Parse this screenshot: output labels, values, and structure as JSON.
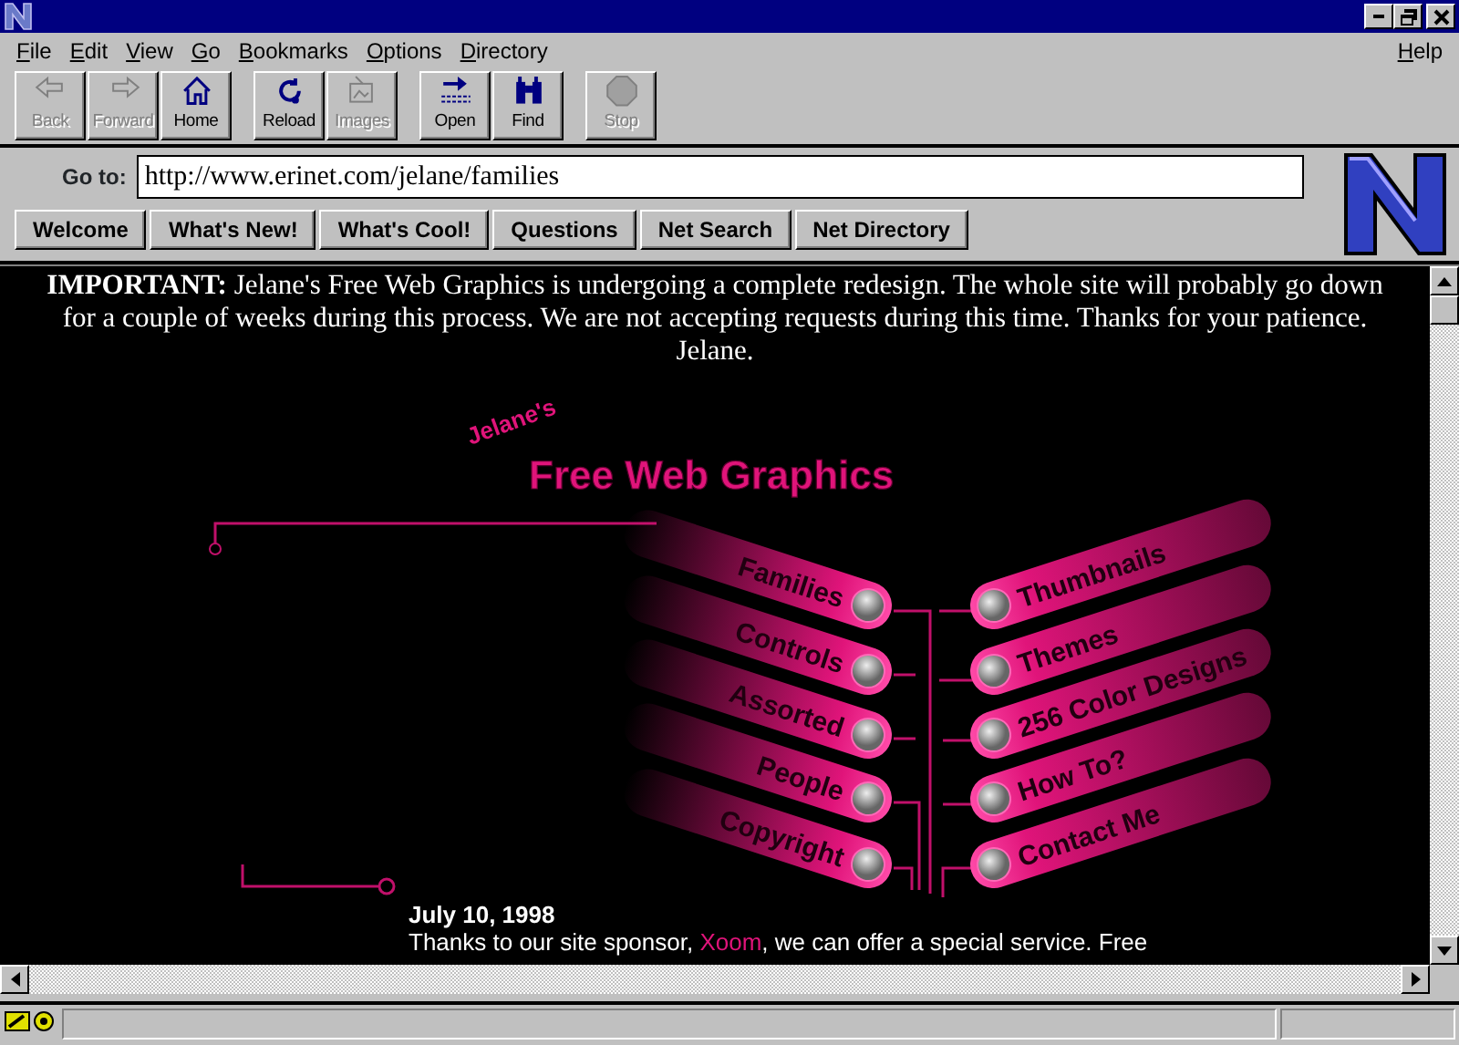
{
  "menu": {
    "items": [
      {
        "label": "File"
      },
      {
        "label": "Edit"
      },
      {
        "label": "View"
      },
      {
        "label": "Go"
      },
      {
        "label": "Bookmarks"
      },
      {
        "label": "Options"
      },
      {
        "label": "Directory"
      }
    ],
    "help": {
      "label": "Help"
    }
  },
  "toolbar": [
    [
      {
        "kind": "back",
        "label": "Back",
        "disabled": true
      },
      {
        "kind": "forward",
        "label": "Forward",
        "disabled": true
      },
      {
        "kind": "home",
        "label": "Home",
        "disabled": false
      }
    ],
    [
      {
        "kind": "reload",
        "label": "Reload",
        "disabled": false
      },
      {
        "kind": "images",
        "label": "Images",
        "disabled": true
      }
    ],
    [
      {
        "kind": "open",
        "label": "Open",
        "disabled": false
      },
      {
        "kind": "find",
        "label": "Find",
        "disabled": false
      }
    ],
    [
      {
        "kind": "stop",
        "label": "Stop",
        "disabled": true
      }
    ]
  ],
  "location": {
    "label": "Go to:",
    "value": "http://www.erinet.com/jelane/families"
  },
  "directory_buttons": [
    "Welcome",
    "What's New!",
    "What's Cool!",
    "Questions",
    "Net Search",
    "Net Directory"
  ],
  "page": {
    "notice": "**IMPORTANT:** Jelane's Free Web Graphics is undergoing a complete redesign. The whole site will probably go down for a couple of weeks during this process. We are not accepting requests during this time. Thanks for your patience. Jelane.",
    "logo": {
      "owner": "Jelane's",
      "title": "Free Web Graphics"
    },
    "nav_left": [
      "Families",
      "Controls",
      "Assorted",
      "People",
      "Copyright"
    ],
    "nav_right": [
      "Thumbnails",
      "Themes",
      "256 Color Designs",
      "How To?",
      "Contact Me"
    ],
    "news": {
      "date": "July 10, 1998",
      "text_before": "Thanks to our site sponsor, ",
      "link": "Xoom",
      "text_after": ", we can offer a special service. Free"
    }
  }
}
